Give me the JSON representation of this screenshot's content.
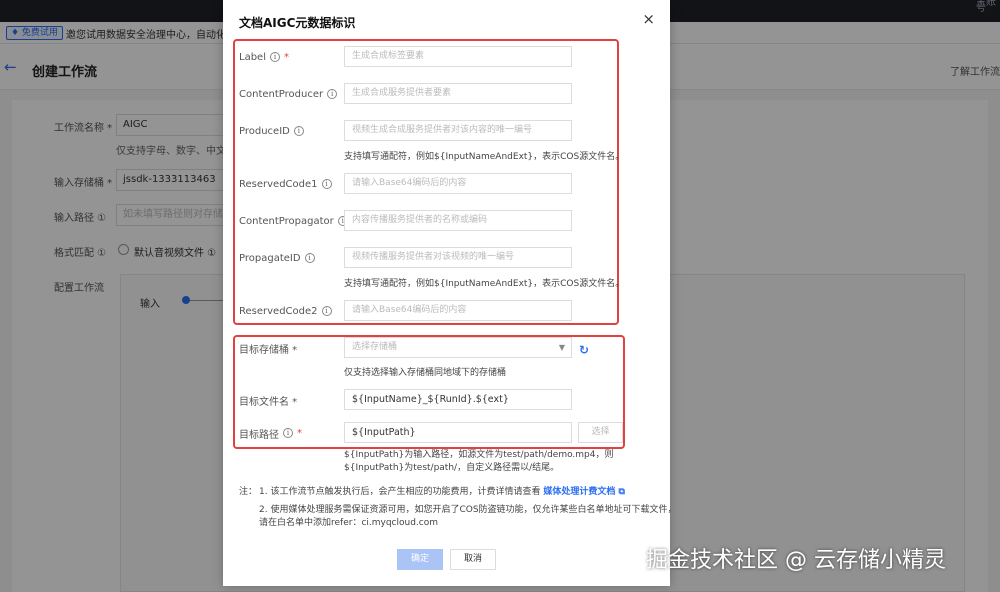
{
  "background": {
    "topbar": {
      "right_text": "主账号"
    },
    "trial": {
      "tag": "♦ 免费试用",
      "text": "邀您试用数据安全治理中心，自动化识别..."
    },
    "header": {
      "back": "←",
      "title": "创建工作流",
      "doc_link": "了解工作流"
    },
    "form": {
      "name_label": "工作流名称 *",
      "name_value": "AIGC",
      "name_hint": "仅支持字母、数字、中文、...",
      "bucket_label": "输入存储桶 *",
      "bucket_value": "jssdk-1333113463",
      "path_label": "输入路径 ①",
      "path_placeholder": "如未填写路径则对存储桶下所有...",
      "pattern_label": "格式匹配 ①",
      "pattern_option": "默认音视频文件 ①",
      "config_label": "配置工作流",
      "node_input": "输入"
    }
  },
  "modal": {
    "title": "文档AIGC元数据标识",
    "close": "×",
    "fields": [
      {
        "label": "Label",
        "info": "i",
        "required": "*",
        "placeholder": "生成合成标签要素"
      },
      {
        "label": "ContentProducer",
        "info": "i",
        "required": "",
        "placeholder": "生成合成服务提供者要素"
      },
      {
        "label": "ProduceID",
        "info": "i",
        "required": "",
        "placeholder": "视频生成合成服务提供者对该内容的唯一编号",
        "hint": "支持填写通配符，例如${InputNameAndExt}，表示COS源文件名。"
      },
      {
        "label": "ReservedCode1",
        "info": "i",
        "required": "",
        "placeholder": "请输入Base64编码后的内容"
      },
      {
        "label": "ContentPropagator",
        "info": "i",
        "required": "",
        "placeholder": "内容传播服务提供者的名称或编码"
      },
      {
        "label": "PropagateID",
        "info": "i",
        "required": "",
        "placeholder": "视频传播服务提供者对该视频的唯一编号",
        "hint": "支持填写通配符，例如${InputNameAndExt}，表示COS源文件名。"
      },
      {
        "label": "ReservedCode2",
        "info": "i",
        "required": "",
        "placeholder": "请输入Base64编码后的内容"
      }
    ],
    "target_bucket": {
      "label": "目标存储桶 *",
      "placeholder": "选择存储桶",
      "arrow": "▼",
      "refresh": "↻",
      "hint": "仅支持选择输入存储桶同地域下的存储桶"
    },
    "target_filename": {
      "label": "目标文件名 *",
      "value": "${InputName}_${RunId}.${ext}"
    },
    "target_path": {
      "label": "目标路径",
      "info": "i",
      "required": "*",
      "value": "${InputPath}",
      "choose": "选择"
    },
    "path_desc": "${InputPath}为输入路径，如源文件为test/path/demo.mp4，则 ${InputPath}为test/path/，自定义路径需以/结尾。",
    "notes": {
      "prefix": "注：",
      "line1": "1. 该工作流节点触发执行后，会产生相应的功能费用，计费详情请查看",
      "line1_link": "媒体处理计费文档 ⧉",
      "line2": "2. 使用媒体处理服务需保证资源可用，如您开启了COS防盗链功能，仅允许某些白名单地址可下载文件，",
      "line3": "请在白名单中添加refer：ci.myqcloud.com"
    },
    "ok": "确定",
    "cancel": "取消"
  },
  "watermark": "掘金技术社区 @ 云存储小精灵"
}
